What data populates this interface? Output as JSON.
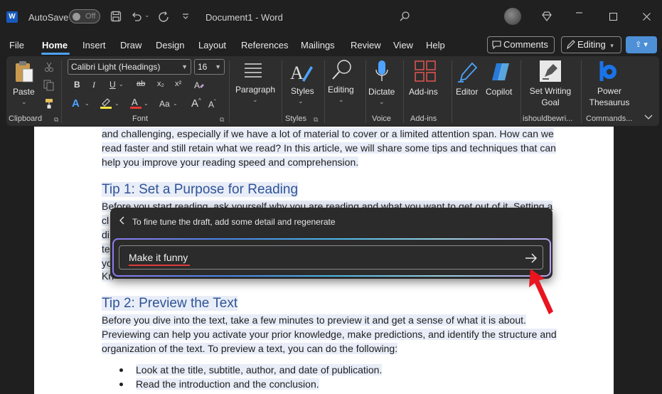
{
  "titlebar": {
    "autosave_label": "AutoSave",
    "autosave_state": "Off",
    "doc_title": "Document1 - Word"
  },
  "menu": {
    "items": [
      "File",
      "Home",
      "Insert",
      "Draw",
      "Design",
      "Layout",
      "References",
      "Mailings",
      "Review",
      "View",
      "Help"
    ],
    "comments_label": "Comments",
    "editing_label": "Editing"
  },
  "ribbon": {
    "paste_label": "Paste",
    "font_name": "Calibri Light (Headings)",
    "font_size": "16",
    "paragraph_label": "Paragraph",
    "styles_label": "Styles",
    "editing_label": "Editing",
    "dictate_label": "Dictate",
    "addins_label": "Add-ins",
    "editor_label": "Editor",
    "copilot_label": "Copilot",
    "set_writing_goal_line1": "Set Writing",
    "set_writing_goal_line2": "Goal",
    "power_thesaurus_line1": "Power",
    "power_thesaurus_line2": "Thesaurus",
    "groups": {
      "clipboard": "Clipboard",
      "font": "Font",
      "styles": "Styles",
      "voice": "Voice",
      "addins": "Add-ins",
      "ishouldbewri": "ishouldbewri...",
      "commands": "Commands..."
    }
  },
  "document": {
    "para1": [
      "and challenging, especially if we have a lot of material to cover or a limited attention span. How can we",
      "read faster and still retain what we read? In this article, we will share some tips and techniques that can",
      "help you improve your reading speed and comprehension."
    ],
    "heading1": "Tip 1: Set a Purpose for Reading",
    "para2_line1": "Before you start reading, ask yourself why you are reading and what you want to get out of it. Setting a",
    "para2_fragments": [
      "cl",
      "di",
      "te",
      "yo",
      "Kn"
    ],
    "heading2": "Tip 2: Preview the Text",
    "para3": [
      "Before you dive into the text, take a few minutes to preview it and get a sense of what it is about.",
      "Previewing can help you activate your prior knowledge, make predictions, and identify the structure and",
      "organization of the text. To preview a text, you can do the following:"
    ],
    "bullets": [
      "Look at the title, subtitle, author, and date of publication.",
      "Read the introduction and the conclusion."
    ]
  },
  "copilot_popup": {
    "instruction": "To fine tune the draft, add some detail and regenerate",
    "input_value": "Make it funny"
  },
  "colors": {
    "accent": "#4da3ff",
    "heading": "#2f5496",
    "annotation_arrow": "#e8141e"
  }
}
